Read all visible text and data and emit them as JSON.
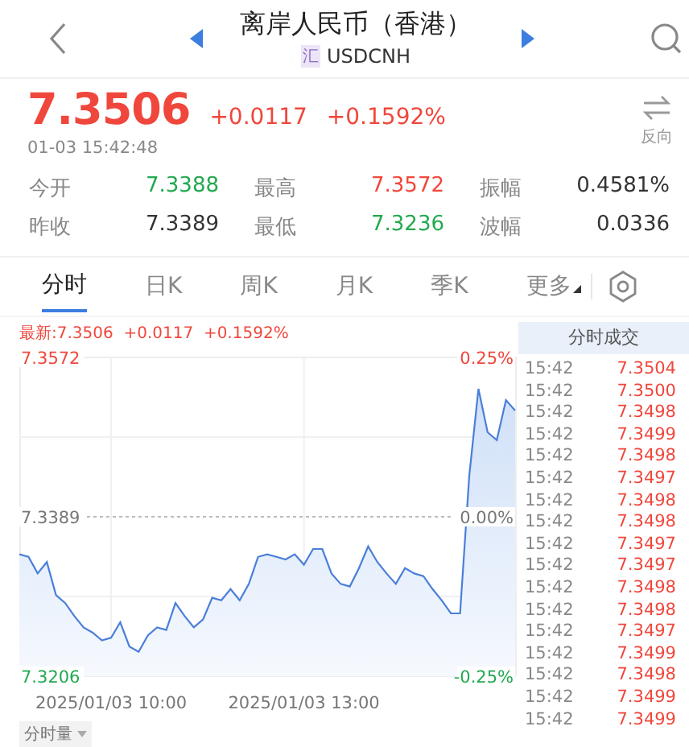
{
  "header": {
    "title": "离岸人民币（香港）",
    "badge": "汇",
    "symbol": "USDCNH"
  },
  "quote": {
    "price": "7.3506",
    "change": "+0.0117",
    "change_pct": "+0.1592%",
    "time": "01-03 15:42:48",
    "reverse_label": "反向"
  },
  "stats": [
    [
      {
        "label": "今开",
        "value": "7.3388",
        "color": "#22a950"
      },
      {
        "label": "最高",
        "value": "7.3572",
        "color": "#f0473c"
      },
      {
        "label": "振幅",
        "value": "0.4581%",
        "color": "#333333"
      }
    ],
    [
      {
        "label": "昨收",
        "value": "7.3389",
        "color": "#333333"
      },
      {
        "label": "最低",
        "value": "7.3236",
        "color": "#22a950"
      },
      {
        "label": "波幅",
        "value": "0.0336",
        "color": "#333333"
      }
    ]
  ],
  "tabs": [
    {
      "label": "分时",
      "selected": true,
      "kind": "tab"
    },
    {
      "label": "日K",
      "selected": false,
      "kind": "tab"
    },
    {
      "label": "周K",
      "selected": false,
      "kind": "tab"
    },
    {
      "label": "月K",
      "selected": false,
      "kind": "tab"
    },
    {
      "label": "季K",
      "selected": false,
      "kind": "tab"
    },
    {
      "label": "更多",
      "selected": false,
      "kind": "menu"
    }
  ],
  "latest": "最新:7.3506  +0.0117  +0.1592%",
  "chart_data": {
    "type": "area",
    "categories": [
      null,
      null,
      null,
      null,
      null,
      null,
      null,
      null,
      null,
      null,
      "2025/01/03 10:00",
      null,
      null,
      null,
      null,
      null,
      null,
      null,
      null,
      null,
      null,
      null,
      null,
      null,
      null,
      null,
      null,
      null,
      null,
      null,
      null,
      "2025/01/03 13:00",
      null,
      null,
      null,
      null,
      null,
      null,
      null,
      null,
      null,
      null,
      null,
      null,
      null,
      null,
      null,
      null,
      null,
      null,
      null,
      null,
      null,
      null,
      null
    ],
    "series": [
      {
        "color": "#4a7fd9",
        "values": [
          7.3346,
          7.3343,
          7.3324,
          7.3337,
          7.3299,
          7.329,
          7.3275,
          7.3262,
          7.3256,
          7.3247,
          7.325,
          7.3268,
          7.324,
          7.3234,
          7.3253,
          7.3262,
          7.3259,
          7.329,
          7.3275,
          7.3262,
          7.3271,
          7.3296,
          7.3293,
          7.3306,
          7.3293,
          7.3312,
          7.3343,
          7.3346,
          7.3343,
          7.334,
          7.3346,
          7.3334,
          7.3352,
          7.3352,
          7.3324,
          7.3312,
          7.3309,
          7.333,
          7.3355,
          7.3337,
          7.3324,
          7.3312,
          7.333,
          7.3324,
          7.3321,
          7.3306,
          7.3293,
          7.3278,
          7.3278,
          7.3436,
          7.3536,
          7.3486,
          7.3477,
          7.3523,
          7.3511
        ]
      }
    ],
    "ylim": [
      7.3206,
      7.3572
    ],
    "yticks": [
      {
        "value": 7.3572,
        "label": "7.3572"
      },
      {
        "value": 7.3389,
        "label": "7.3389"
      },
      {
        "value": 7.3206,
        "label": "7.3206"
      }
    ]
  },
  "percent_labels": [
    "0.25%",
    "0.00%",
    "-0.25%"
  ],
  "volume_button": "分时量",
  "trades": {
    "title": "分时成交",
    "rows": [
      {
        "time": "15:42",
        "price": "7.3504",
        "color": "#f0473c"
      },
      {
        "time": "15:42",
        "price": "7.3500",
        "color": "#f0473c"
      },
      {
        "time": "15:42",
        "price": "7.3498",
        "color": "#f0473c"
      },
      {
        "time": "15:42",
        "price": "7.3499",
        "color": "#f0473c"
      },
      {
        "time": "15:42",
        "price": "7.3498",
        "color": "#f0473c"
      },
      {
        "time": "15:42",
        "price": "7.3497",
        "color": "#f0473c"
      },
      {
        "time": "15:42",
        "price": "7.3498",
        "color": "#f0473c"
      },
      {
        "time": "15:42",
        "price": "7.3498",
        "color": "#f0473c"
      },
      {
        "time": "15:42",
        "price": "7.3497",
        "color": "#f0473c"
      },
      {
        "time": "15:42",
        "price": "7.3497",
        "color": "#f0473c"
      },
      {
        "time": "15:42",
        "price": "7.3498",
        "color": "#f0473c"
      },
      {
        "time": "15:42",
        "price": "7.3498",
        "color": "#f0473c"
      },
      {
        "time": "15:42",
        "price": "7.3497",
        "color": "#f0473c"
      },
      {
        "time": "15:42",
        "price": "7.3499",
        "color": "#f0473c"
      },
      {
        "time": "15:42",
        "price": "7.3498",
        "color": "#f0473c"
      },
      {
        "time": "15:42",
        "price": "7.3499",
        "color": "#f0473c"
      },
      {
        "time": "15:42",
        "price": "7.3499",
        "color": "#f0473c"
      }
    ]
  }
}
